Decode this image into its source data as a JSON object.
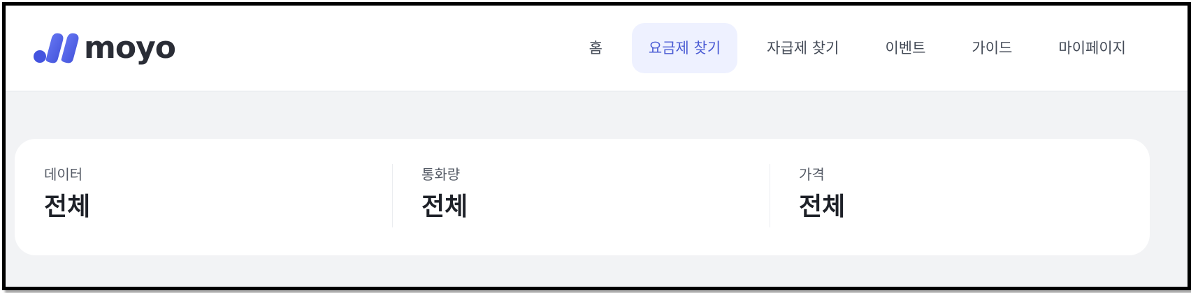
{
  "brand": {
    "name": "moyo",
    "logo_icon": "moyo-logo-mark",
    "accent_color": "#4a5bd4"
  },
  "nav": {
    "items": [
      {
        "label": "홈",
        "active": false
      },
      {
        "label": "요금제 찾기",
        "active": true
      },
      {
        "label": "자급제 찾기",
        "active": false
      },
      {
        "label": "이벤트",
        "active": false
      },
      {
        "label": "가이드",
        "active": false
      },
      {
        "label": "마이페이지",
        "active": false
      }
    ]
  },
  "filters": [
    {
      "label": "데이터",
      "value": "전체"
    },
    {
      "label": "통화량",
      "value": "전체"
    },
    {
      "label": "가격",
      "value": "전체"
    }
  ]
}
